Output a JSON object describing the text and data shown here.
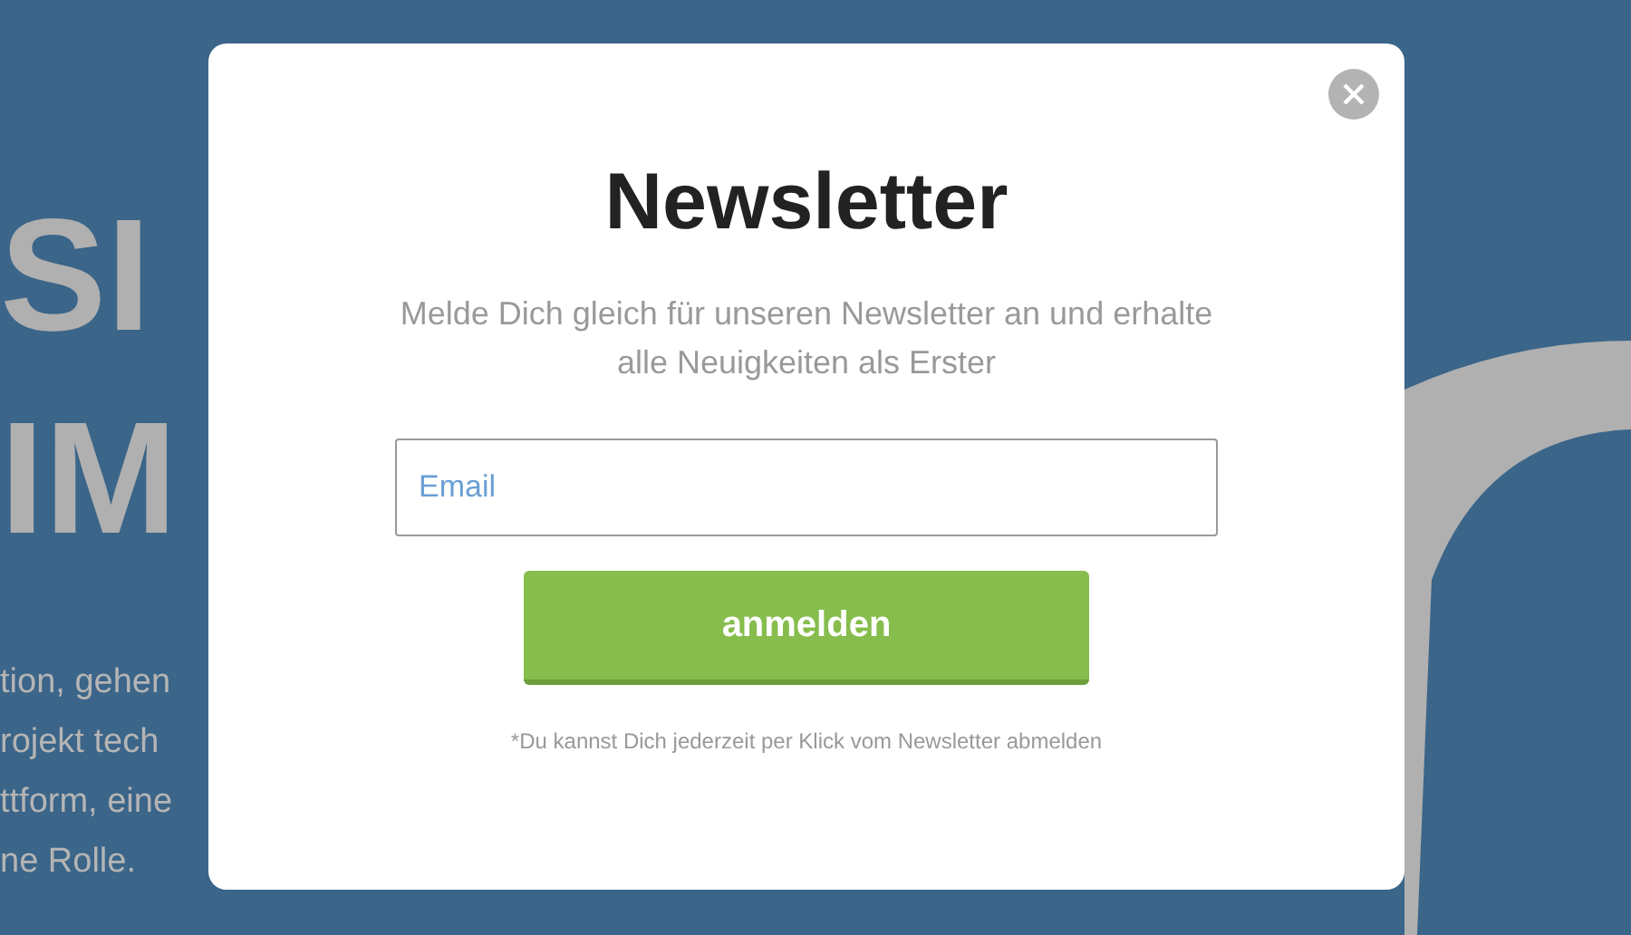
{
  "background": {
    "headline_lines": [
      "SI",
      "IM"
    ],
    "body_lines": [
      "tion, gehen",
      "rojekt tech",
      "ttform, eine",
      "ne Rolle."
    ]
  },
  "modal": {
    "title": "Newsletter",
    "description": "Melde Dich gleich für unseren Newsletter an und erhalte alle Neuigkeiten als Erster",
    "email_field": {
      "placeholder": "Email"
    },
    "submit_button": "anmelden",
    "footnote": "*Du kannst Dich jederzeit per Klick vom Newsletter abmelden"
  }
}
